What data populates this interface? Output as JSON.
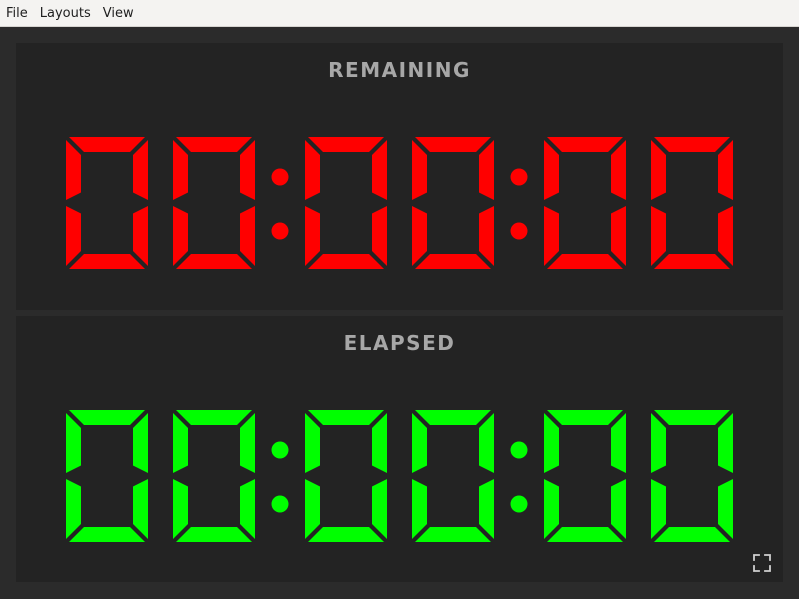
{
  "menubar": {
    "items": [
      {
        "label": "File"
      },
      {
        "label": "Layouts"
      },
      {
        "label": "View"
      }
    ]
  },
  "remaining": {
    "title": "REMAINING",
    "time": "00:00:00",
    "color": "#ff0000"
  },
  "elapsed": {
    "title": "ELAPSED",
    "time": "00:00:00",
    "color": "#00ff00"
  },
  "controls": {
    "fullscreen_icon": "fullscreen-icon"
  }
}
